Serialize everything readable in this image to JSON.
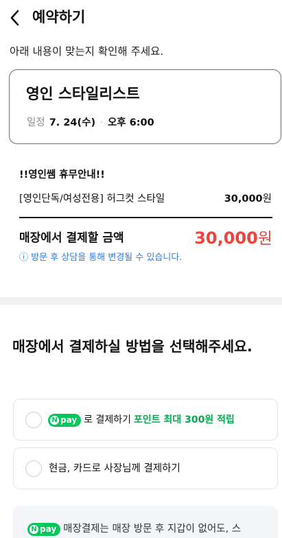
{
  "header": {
    "title": "예약하기"
  },
  "instruction": "아래 내용이 맞는지 확인해 주세요.",
  "shop": {
    "name": "영인 스타일리스트",
    "schedule_label": "일정",
    "date": "7. 24(수)",
    "separator": "·",
    "time": "오후 6:00"
  },
  "order": {
    "notice": "!!영인쌤 휴무안내!!",
    "item_name": "[영인단독/여성전용] 허그컷 스타일",
    "item_price": "30,000",
    "item_currency": "원",
    "total_label": "매장에서 결제할 금액",
    "total_amount": "30,000",
    "total_currency": "원",
    "info_icon": "ⓘ",
    "info_note": "방문 후 상담을 통해 변경될 수 있습니다."
  },
  "payment": {
    "title": "매장에서 결제하실 방법을 선택해주세요.",
    "npay_n": "N",
    "npay_label": "pay",
    "option1_text": "로 결제하기",
    "option1_point": "포인트 최대 300원 적립",
    "option2_text": "현금, 카드로 사장님께 결제하기",
    "bottom_note": "매장결제는 매장 방문 후 지갑이 없어도, 스"
  },
  "colors": {
    "accent_red": "#f0423c",
    "info_blue": "#2f7de1",
    "npay_green": "#03c75a"
  },
  "icons": {
    "back": "chevron-left-icon",
    "info": "info-icon",
    "radio": "radio-unchecked-icon"
  }
}
